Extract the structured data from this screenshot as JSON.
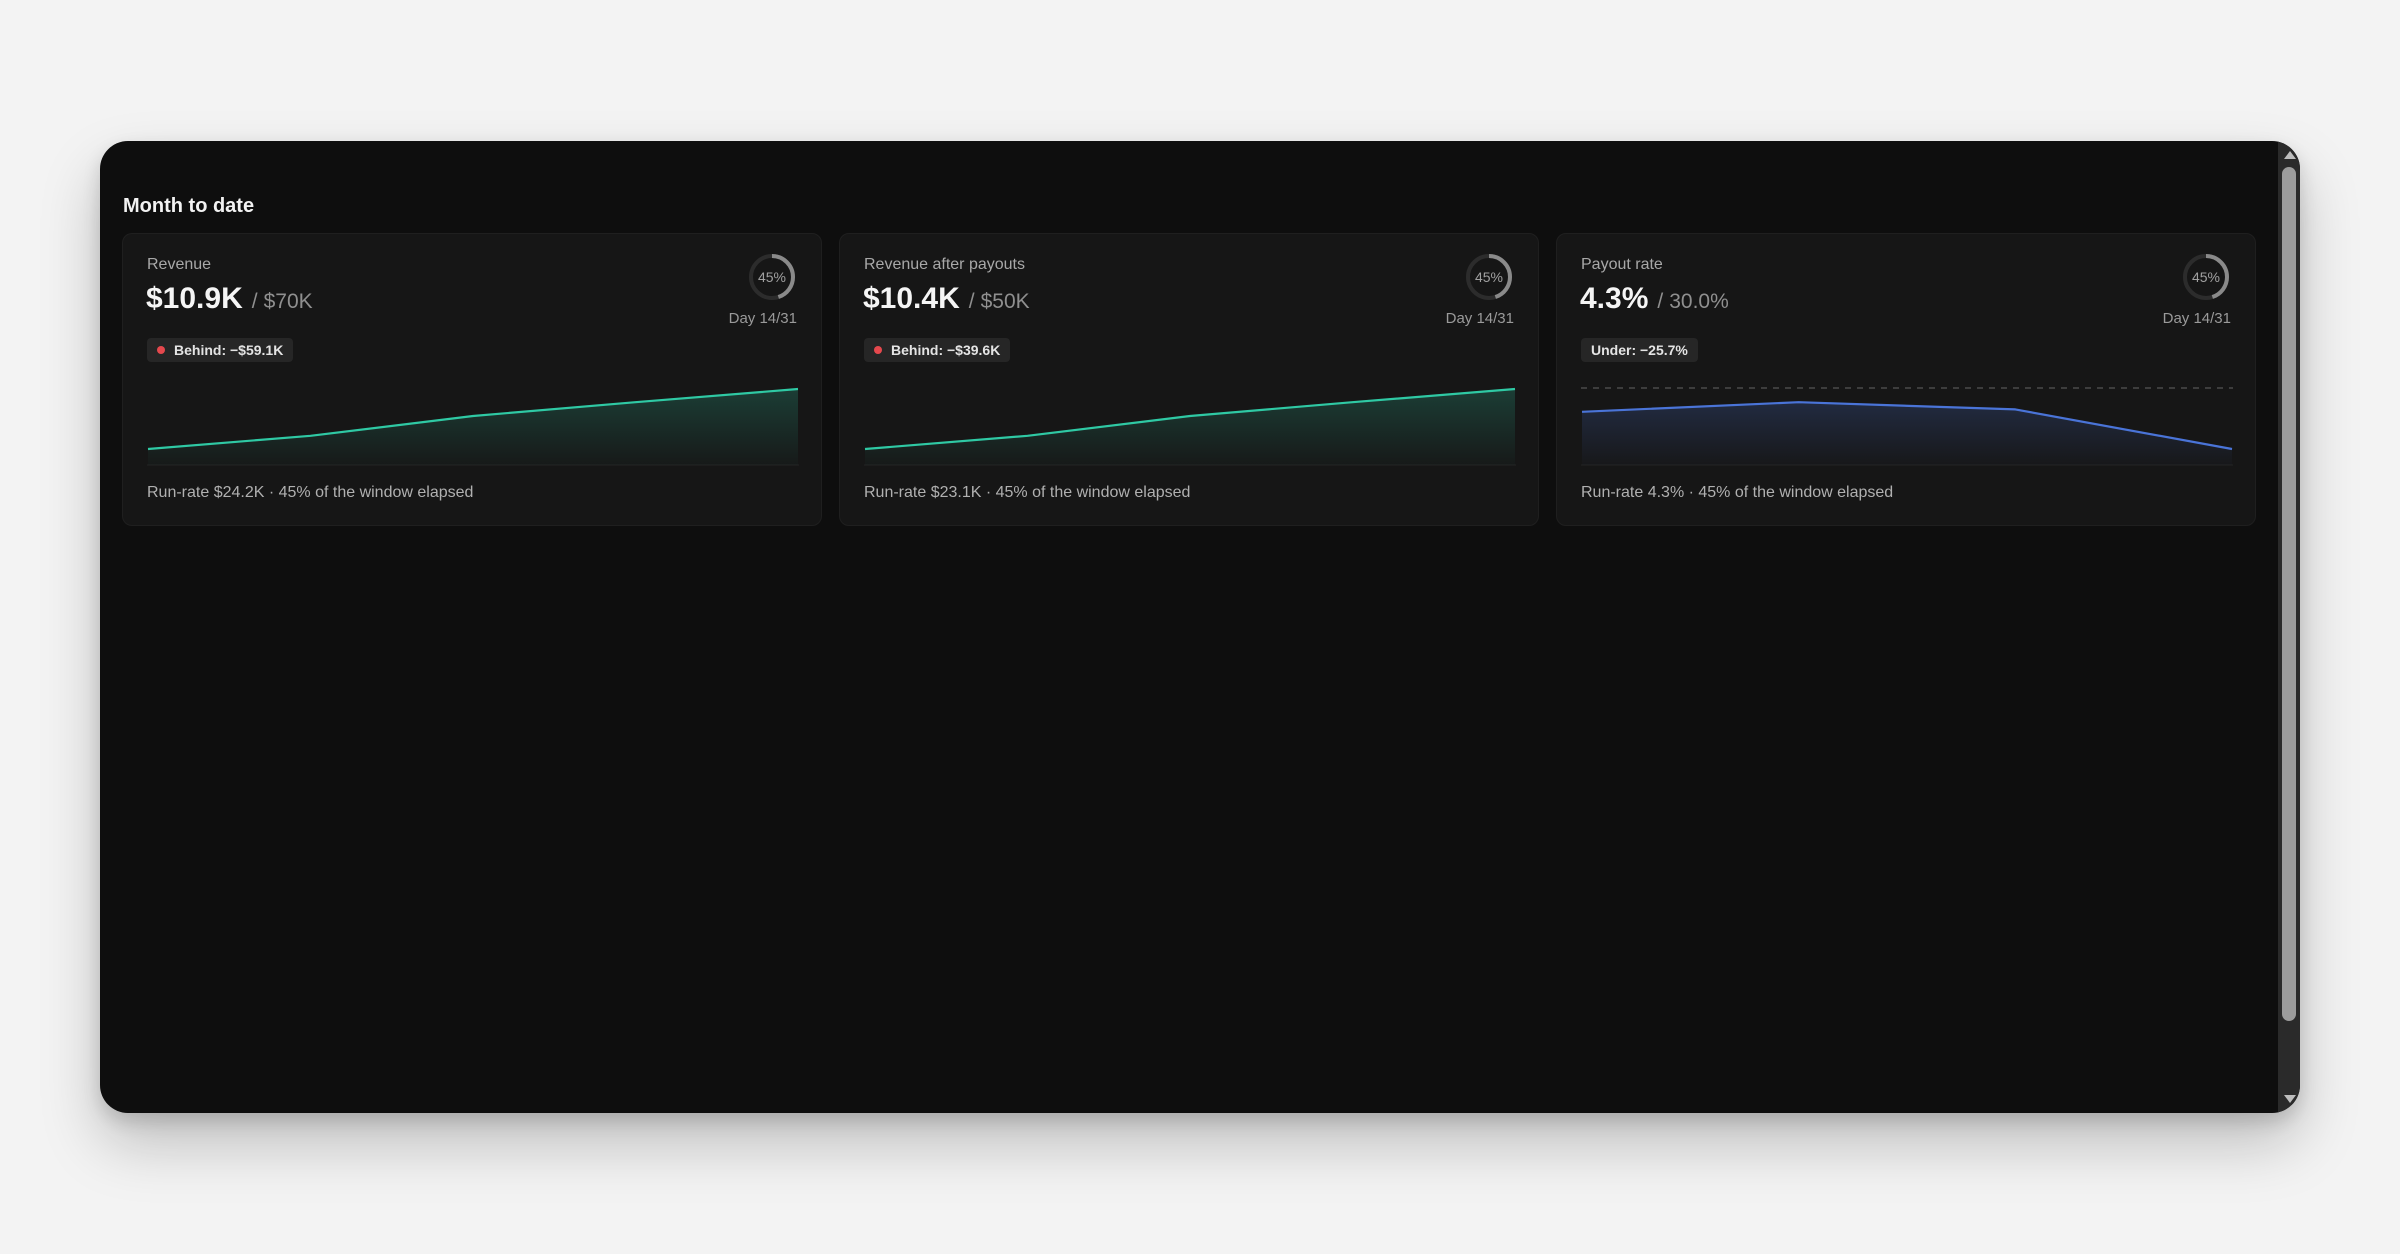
{
  "section": {
    "title": "Month to date"
  },
  "colors": {
    "accent_green": "#2fc9a4",
    "accent_blue": "#4a74d8",
    "behind_dot": "#e5484d"
  },
  "cards": [
    {
      "label": "Revenue",
      "value": "$10.9K",
      "separator": "/",
      "target": "$70K",
      "progress_percent": 45,
      "progress_label": "45%",
      "day": "Day 14/31",
      "badge": {
        "text": "Behind: −$59.1K",
        "show_dot": true
      },
      "run_rate": "Run-rate $24.2K · 45% of the window elapsed",
      "chart_data": {
        "type": "area",
        "color": "#2fc9a4",
        "values": [
          0.0,
          0.22,
          0.55,
          0.78,
          1.0
        ],
        "target_line": null
      }
    },
    {
      "label": "Revenue after payouts",
      "value": "$10.4K",
      "separator": "/",
      "target": "$50K",
      "progress_percent": 45,
      "progress_label": "45%",
      "day": "Day 14/31",
      "badge": {
        "text": "Behind: −$39.6K",
        "show_dot": true
      },
      "run_rate": "Run-rate $23.1K · 45% of the window elapsed",
      "chart_data": {
        "type": "area",
        "color": "#2fc9a4",
        "values": [
          0.0,
          0.22,
          0.55,
          0.78,
          1.0
        ],
        "target_line": null
      }
    },
    {
      "label": "Payout rate",
      "value": "4.3%",
      "separator": "/",
      "target": "30.0%",
      "progress_percent": 45,
      "progress_label": "45%",
      "day": "Day 14/31",
      "badge": {
        "text": "Under: −25.7%",
        "show_dot": false
      },
      "run_rate": "Run-rate 4.3% · 45% of the window elapsed",
      "chart_data": {
        "type": "area",
        "color": "#4a74d8",
        "values": [
          0.62,
          0.78,
          0.66,
          0.0
        ],
        "target_line": 1.0
      }
    }
  ]
}
